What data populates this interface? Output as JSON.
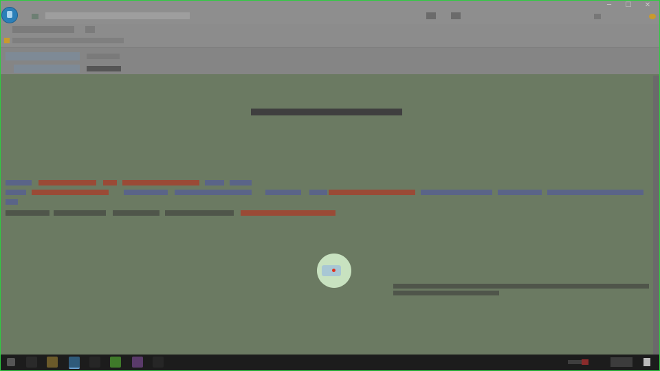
{
  "window": {
    "title": "",
    "controls": [
      "─",
      "☐",
      "✕"
    ]
  },
  "header": {
    "label_1": "",
    "value_1": "",
    "label_2": "",
    "value_2": ""
  },
  "main": {
    "heading": ""
  },
  "colors": {
    "titlebar": "#8e8e8e",
    "page_background": "#6b7a62",
    "link_blue": "#5a6488",
    "link_red": "#9a4a36",
    "cursor_highlight": "#c8e2c0",
    "cursor_dot": "#e0301e",
    "taskbar": "#1c1c1c"
  },
  "icons": {
    "app": "app-logo-icon",
    "bookmark": "folder-icon",
    "start": "windows-start-icon"
  }
}
